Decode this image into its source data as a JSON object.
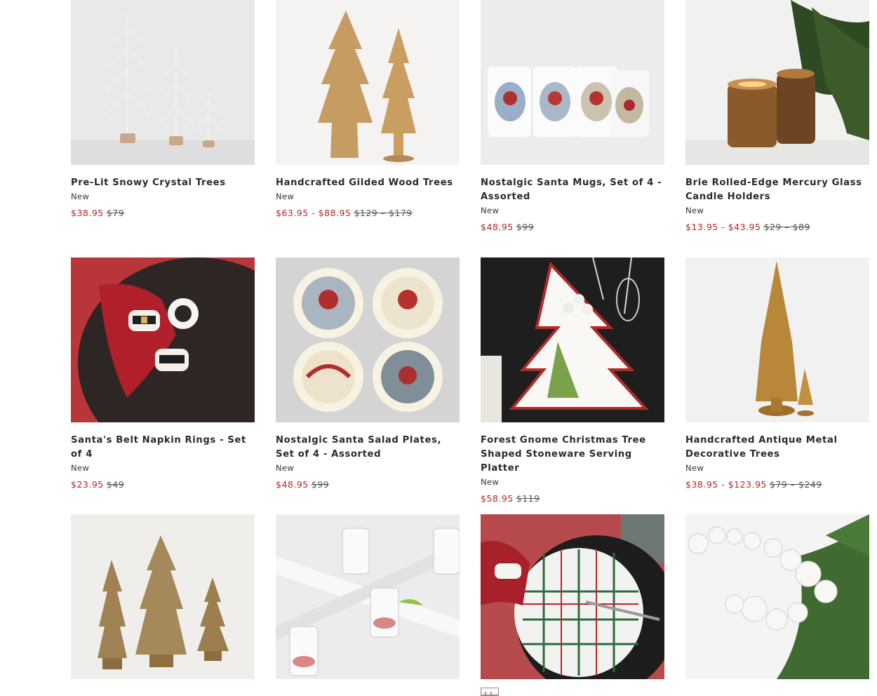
{
  "products": [
    {
      "title": "Pre-Lit Snowy Crystal Trees",
      "tag": "New",
      "sale": "$38.95",
      "orig": "$79"
    },
    {
      "title": "Handcrafted Gilded Wood Trees",
      "tag": "New",
      "sale": "$63.95 - $88.95",
      "orig": "$129 – $179"
    },
    {
      "title": "Nostalgic Santa Mugs, Set of 4 - Assorted",
      "tag": "New",
      "sale": "$48.95",
      "orig": "$99"
    },
    {
      "title": "Brie Rolled-Edge Mercury Glass Candle Holders",
      "tag": "New",
      "sale": "$13.95 - $43.95",
      "orig": "$29 – $89"
    },
    {
      "title": "Santa's Belt Napkin Rings - Set of 4",
      "tag": "New",
      "sale": "$23.95",
      "orig": "$49"
    },
    {
      "title": "Nostalgic Santa Salad Plates, Set of 4 - Assorted",
      "tag": "New",
      "sale": "$48.95",
      "orig": "$99"
    },
    {
      "title": "Forest Gnome Christmas Tree Shaped Stoneware Serving Platter",
      "tag": "New",
      "sale": "$58.95",
      "orig": "$119"
    },
    {
      "title": "Handcrafted Antique Metal Decorative Trees",
      "tag": "New",
      "sale": "$38.95 - $123.95",
      "orig": "$79 – $249"
    }
  ],
  "colors": {
    "sale": "#b3262a",
    "text": "#2b2b2b"
  }
}
